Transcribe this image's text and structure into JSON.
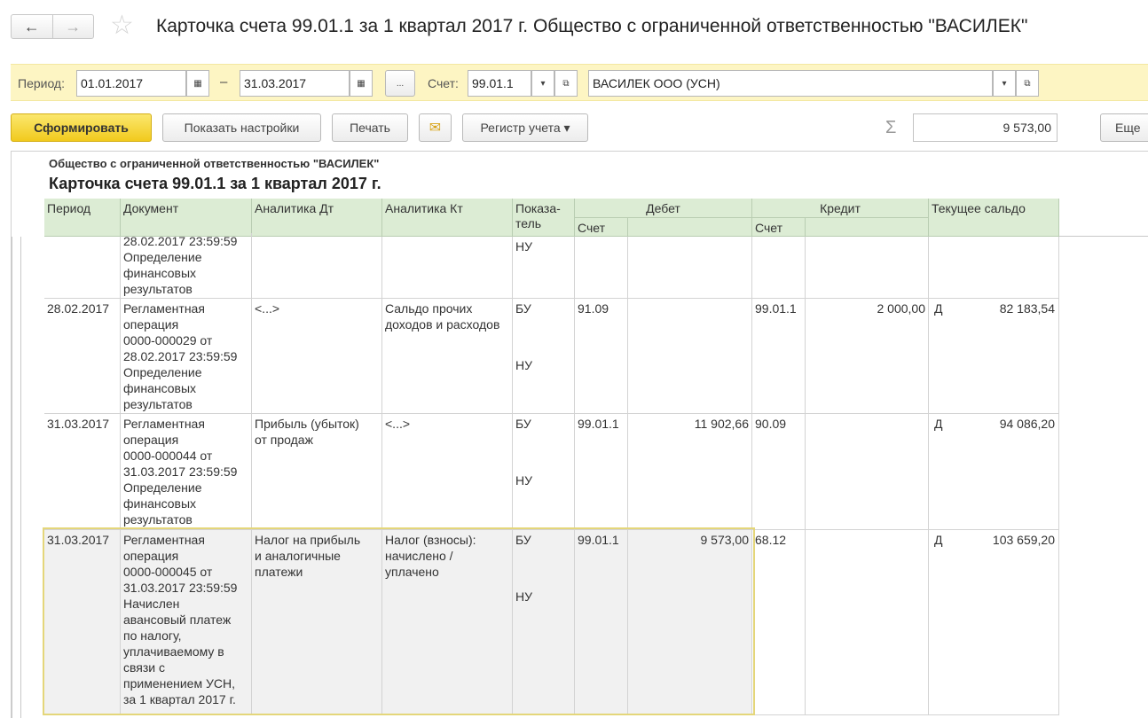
{
  "window": {
    "title": "Карточка счета 99.01.1 за 1 квартал 2017 г. Общество с ограниченной ответственностью \"ВАСИЛЕК\"",
    "back_icon": "←",
    "forward_icon": "→",
    "star_icon": "☆"
  },
  "params": {
    "period_label": "Период:",
    "date_from": "01.01.2017",
    "date_to": "31.03.2017",
    "dash": "–",
    "calendar_icon": "▦",
    "period_select": "...",
    "account_label": "Счет:",
    "account_value": "99.01.1",
    "dropdown_icon": "▾",
    "open_icon": "⧉",
    "org_value": "ВАСИЛЕК ООО (УСН)"
  },
  "toolbar": {
    "generate": "Сформировать",
    "show_settings": "Показать настройки",
    "print": "Печать",
    "mail_icon": "✉",
    "register": "Регистр учета ▾",
    "sigma": "Σ",
    "sum_value": "9 573,00",
    "more": "Еще"
  },
  "report": {
    "org_name": "Общество с ограниченной ответственностью \"ВАСИЛЕК\"",
    "title": "Карточка счета 99.01.1 за 1 квартал 2017 г.",
    "headers": {
      "period": "Период",
      "document": "Документ",
      "analytics_dt": "Аналитика Дт",
      "analytics_kt": "Аналитика Кт",
      "indicator": "Показа-\nтель",
      "debit": "Дебет",
      "debit_account": "Счет",
      "credit": "Кредит",
      "credit_account": "Счет",
      "balance": "Текущее сальдо"
    },
    "rows": [
      {
        "period": "",
        "document": "28.02.2017 23:59:59\nОпределение\nфинансовых\nрезультатов",
        "analytics_dt": "",
        "analytics_kt": "",
        "indicator_bu": "НУ",
        "indicator_nu": "",
        "debit_account": "",
        "debit_amount": "",
        "credit_account": "",
        "credit_amount": "",
        "balance_side": "",
        "balance_amount": ""
      },
      {
        "period": "28.02.2017",
        "document": "Регламентная\nоперация\n0000-000029 от\n28.02.2017 23:59:59\nОпределение\nфинансовых\nрезультатов",
        "analytics_dt": "<...>",
        "analytics_kt": "Сальдо прочих\nдоходов и расходов",
        "indicator_bu": "БУ",
        "indicator_nu": "НУ",
        "debit_account": "91.09",
        "debit_amount": "",
        "credit_account": "99.01.1",
        "credit_amount": "2 000,00",
        "balance_side": "Д",
        "balance_amount": "82 183,54"
      },
      {
        "period": "31.03.2017",
        "document": "Регламентная\nоперация\n0000-000044 от\n31.03.2017 23:59:59\nОпределение\nфинансовых\nрезультатов",
        "analytics_dt": "Прибыль (убыток)\nот продаж",
        "analytics_kt": "<...>",
        "indicator_bu": "БУ",
        "indicator_nu": "НУ",
        "debit_account": "99.01.1",
        "debit_amount": "11 902,66",
        "credit_account": "90.09",
        "credit_amount": "",
        "balance_side": "Д",
        "balance_amount": "94 086,20"
      },
      {
        "period": "31.03.2017",
        "document": "Регламентная\nоперация\n0000-000045 от\n31.03.2017 23:59:59\nНачислен\nавансовый платеж\nпо налогу,\nуплачиваемому в\nсвязи с\nприменением УСН,\nза 1 квартал 2017 г.",
        "analytics_dt": "Налог на прибыль\nи аналогичные\nплатежи",
        "analytics_kt": "Налог (взносы):\nначислено /\nуплачено",
        "indicator_bu": "БУ",
        "indicator_nu": "НУ",
        "debit_account": "99.01.1",
        "debit_amount": "9 573,00",
        "credit_account": "68.12",
        "credit_amount": "",
        "balance_side": "Д",
        "balance_amount": "103 659,20"
      }
    ]
  }
}
